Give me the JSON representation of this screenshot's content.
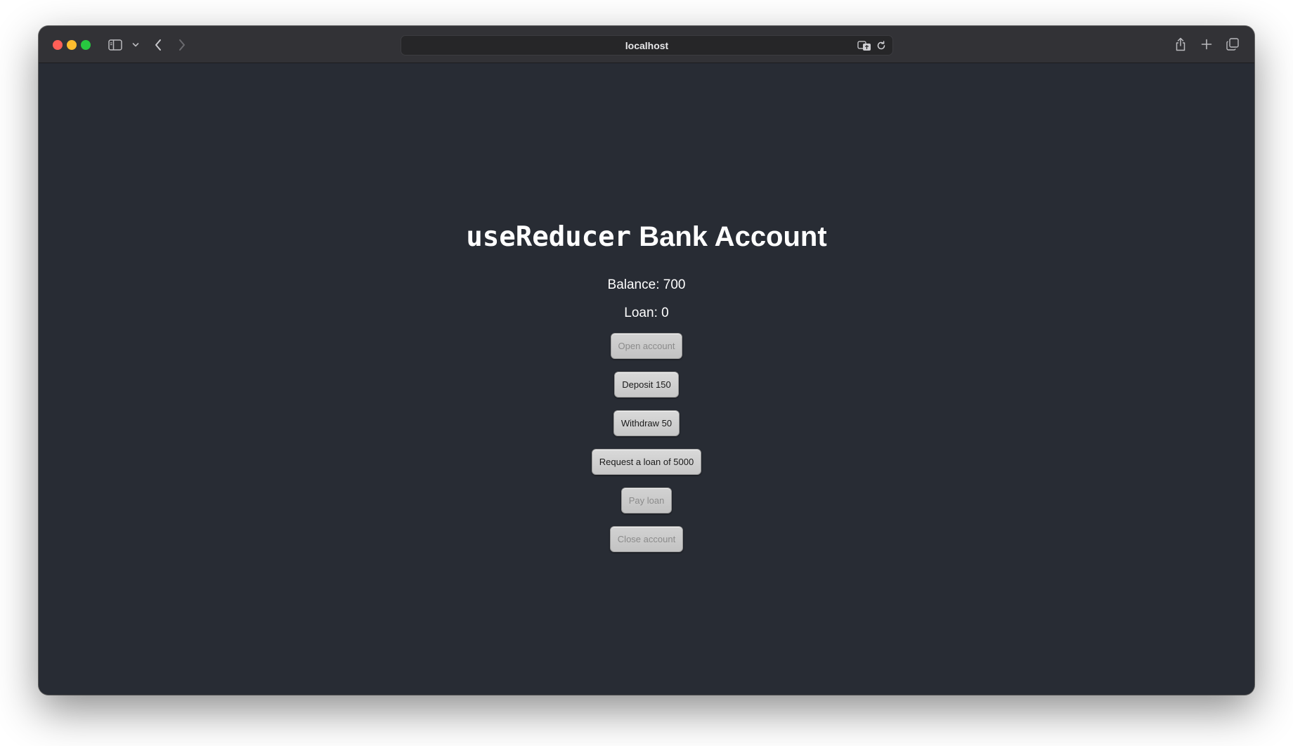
{
  "browser": {
    "url": "localhost",
    "icons": {
      "sidebar": "sidebar-toggle-icon",
      "chevron": "chevron-down-icon",
      "back": "chevron-left-icon",
      "forward": "chevron-right-icon",
      "translate": "translate-icon",
      "reload": "reload-icon",
      "share": "share-icon",
      "new_tab": "plus-icon",
      "tabs": "tabs-overview-icon"
    },
    "colors": {
      "close": "#ff5f57",
      "minimize": "#febc2e",
      "maximize": "#28c840"
    }
  },
  "app": {
    "title_code": "useReducer",
    "title_rest": " Bank Account",
    "balance_text": "Balance: 700",
    "loan_text": "Loan: 0",
    "background": "#282c34",
    "buttons": [
      {
        "label": "Open account",
        "disabled": true
      },
      {
        "label": "Deposit 150",
        "disabled": false
      },
      {
        "label": "Withdraw 50",
        "disabled": false
      },
      {
        "label": "Request a loan of 5000",
        "disabled": false
      },
      {
        "label": "Pay loan",
        "disabled": true
      },
      {
        "label": "Close account",
        "disabled": true
      }
    ]
  }
}
